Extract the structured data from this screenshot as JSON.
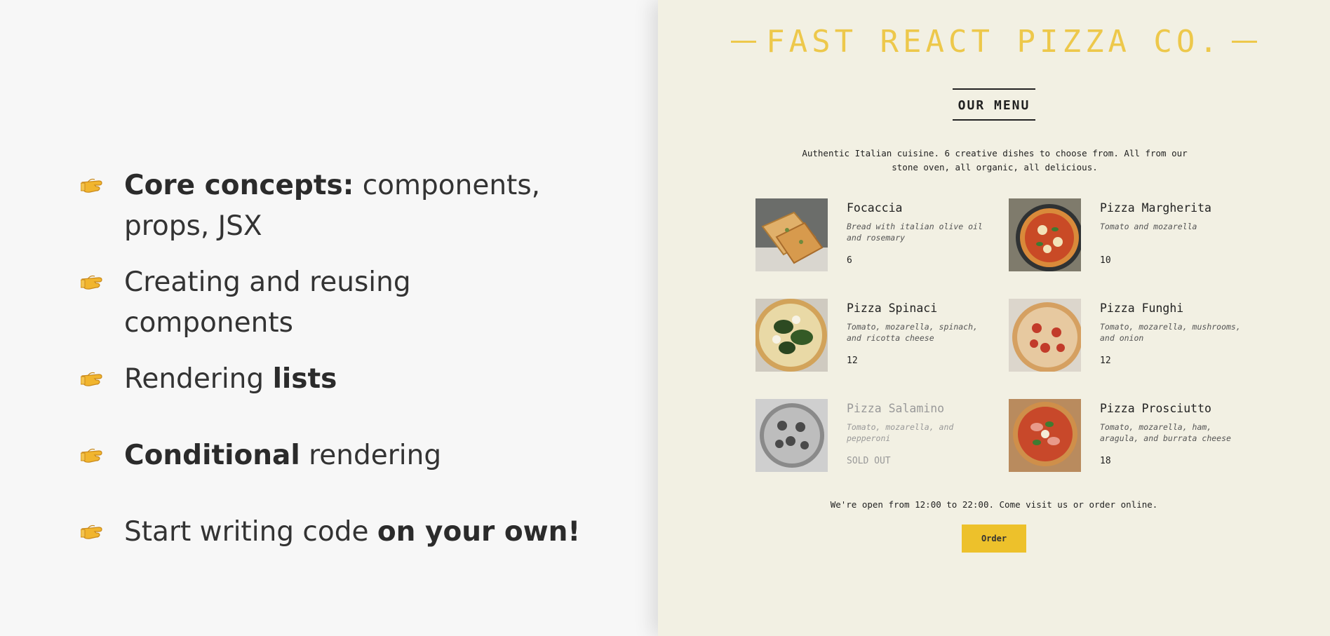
{
  "slide": {
    "bullets": [
      {
        "bold": "Core concepts:",
        "rest": " components, props, JSX"
      },
      {
        "pre": "Creating and reusing components"
      },
      {
        "pre": "Rendering ",
        "bold": "lists"
      },
      {
        "bold": "Conditional",
        "rest": " rendering"
      },
      {
        "pre": "Start writing code ",
        "bold": "on your own!"
      }
    ],
    "bullet_icon": "pointing-hand-icon"
  },
  "app": {
    "title": "FAST REACT PIZZA CO.",
    "menu_title": "OUR MENU",
    "intro": "Authentic Italian cuisine. 6 creative dishes to choose from. All from our stone oven, all organic, all delicious.",
    "pizzas": [
      {
        "name": "Focaccia",
        "ingredients": "Bread with italian olive oil and rosemary",
        "price": "6"
      },
      {
        "name": "Pizza Margherita",
        "ingredients": "Tomato and mozarella",
        "price": "10"
      },
      {
        "name": "Pizza Spinaci",
        "ingredients": "Tomato, mozarella, spinach, and ricotta cheese",
        "price": "12"
      },
      {
        "name": "Pizza Funghi",
        "ingredients": "Tomato, mozarella, mushrooms, and onion",
        "price": "12"
      },
      {
        "name": "Pizza Salamino",
        "ingredients": "Tomato, mozarella, and pepperoni",
        "price": "SOLD OUT",
        "sold_out": true
      },
      {
        "name": "Pizza Prosciutto",
        "ingredients": "Tomato, mozarella, ham, aragula, and burrata cheese",
        "price": "18"
      }
    ],
    "footer": "We're open from 12:00 to 22:00. Come visit us or order online.",
    "order_label": "Order",
    "colors": {
      "accent": "#edc84b",
      "button": "#edc12b",
      "background": "#f2f0e3"
    }
  }
}
